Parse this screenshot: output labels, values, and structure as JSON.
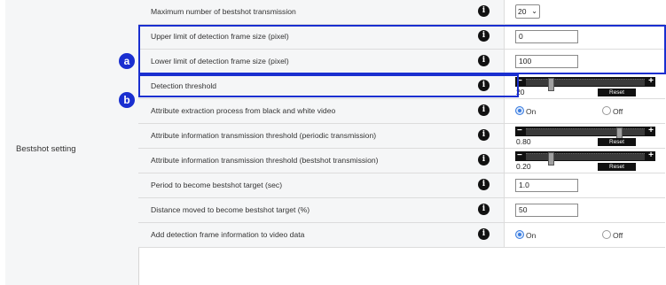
{
  "section": {
    "label": "Bestshot setting"
  },
  "rows": [
    {
      "label": "Maximum number of bestshot transmission",
      "select_value": "20"
    },
    {
      "label": "Upper limit of detection frame size (pixel)",
      "value": "0"
    },
    {
      "label": "Lower limit of detection frame size (pixel)",
      "value": "100"
    },
    {
      "label": "Detection threshold",
      "slider_value": "20",
      "slider_fraction": 0.2,
      "reset_label": "Reset"
    },
    {
      "label": "Attribute extraction process from black and white video",
      "option_on": "On",
      "option_off": "Off",
      "selected": "On"
    },
    {
      "label": "Attribute information transmission threshold (periodic transmission)",
      "slider_value": "0.80",
      "slider_fraction": 0.8,
      "reset_label": "Reset"
    },
    {
      "label": "Attribute information transmission threshold (bestshot transmission)",
      "slider_value": "0.20",
      "slider_fraction": 0.2,
      "reset_label": "Reset"
    },
    {
      "label": "Period to become bestshot target (sec)",
      "value": "1.0"
    },
    {
      "label": "Distance moved to become bestshot target (%)",
      "value": "50"
    },
    {
      "label": "Add detection frame information to video data",
      "option_on": "On",
      "option_off": "Off",
      "selected": "On"
    }
  ],
  "info_icon_glyph": "i",
  "annotations": [
    {
      "letter": "a"
    },
    {
      "letter": "b"
    }
  ],
  "colors": {
    "highlight": "#1a2fd0",
    "radio_selected": "#3b7de0",
    "panel_bg": "#f5f6f7"
  }
}
